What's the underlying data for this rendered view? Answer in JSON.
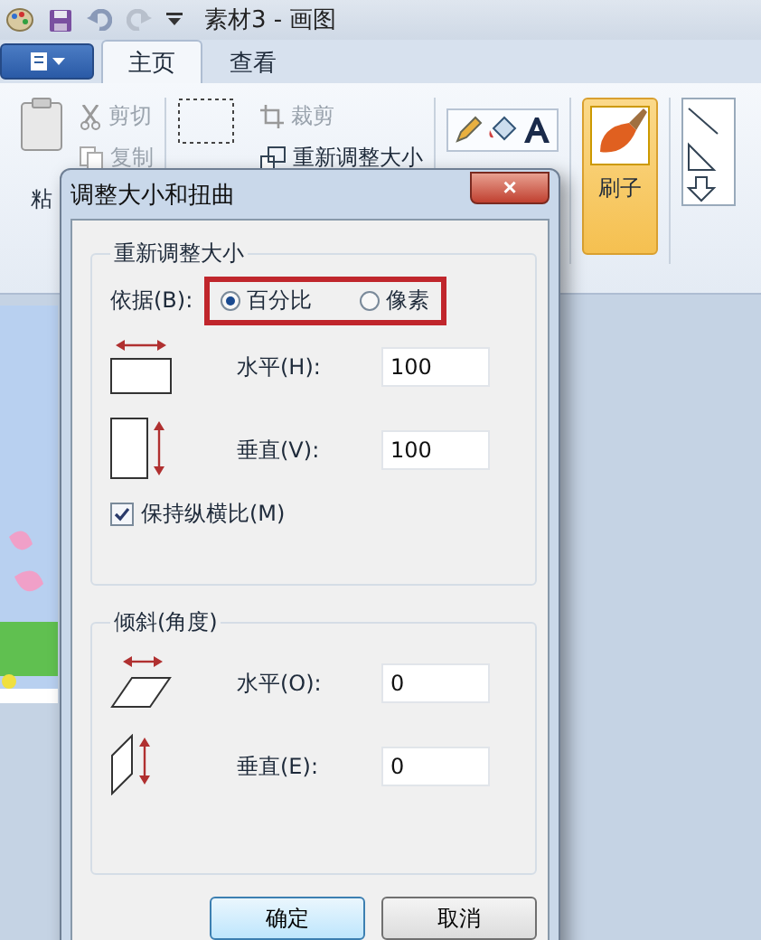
{
  "window": {
    "title": "素材3 - 画图"
  },
  "tabs": [
    {
      "label": "主页",
      "selected": true
    },
    {
      "label": "查看",
      "selected": false
    }
  ],
  "ribbon": {
    "paste": "粘",
    "cut": "剪切",
    "copy": "复制",
    "crop": "裁剪",
    "resize": "重新调整大小",
    "brush": "刷子"
  },
  "dialog": {
    "title": "调整大小和扭曲",
    "close": "×",
    "resize": {
      "title": "重新调整大小",
      "basis_label": "依据(B):",
      "options": [
        {
          "label": "百分比",
          "selected": true
        },
        {
          "label": "像素",
          "selected": false
        }
      ],
      "fields": [
        {
          "label": "水平(H):",
          "value": "100",
          "kind": "horizontal"
        },
        {
          "label": "垂直(V):",
          "value": "100",
          "kind": "vertical"
        }
      ],
      "keep_ratio": {
        "label": "保持纵横比(M)",
        "checked": true
      }
    },
    "skew": {
      "title": "倾斜(角度)",
      "fields": [
        {
          "label": "水平(O):",
          "value": "0",
          "kind": "horizontal"
        },
        {
          "label": "垂直(E):",
          "value": "0",
          "kind": "vertical"
        }
      ]
    },
    "buttons": [
      "确定",
      "取消"
    ]
  }
}
